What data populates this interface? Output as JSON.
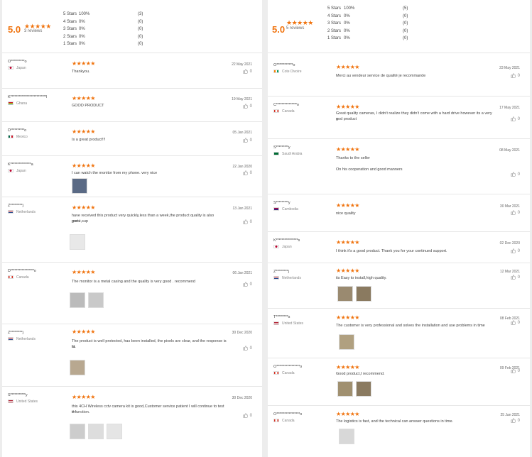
{
  "left": {
    "summary": {
      "score": "5.0",
      "stars": "★★★★★",
      "count": "3 reviews",
      "dist": [
        {
          "label": "5 Stars",
          "pct": "100%",
          "count": "(3)"
        },
        {
          "label": "4 Stars",
          "pct": "0%",
          "count": "(0)"
        },
        {
          "label": "3 Stars",
          "pct": "0%",
          "count": "(0)"
        },
        {
          "label": "2 Stars",
          "pct": "0%",
          "count": "(0)"
        },
        {
          "label": "1 Stars",
          "pct": "0%",
          "count": "(0)"
        }
      ]
    },
    "reviews": [
      {
        "name": "O**********o",
        "country": "Japan",
        "stars": "★★★★★",
        "date": "22 May 2021",
        "lines": [
          "Thankyou."
        ],
        "likes": "0"
      },
      {
        "name": "K**************************l",
        "country": "Ghana",
        "stars": "★★★★★",
        "date": "19 May 2021",
        "lines": [
          "GOOD PRODUCT"
        ],
        "likes": "0"
      },
      {
        "name": "D**********o",
        "country": "Mexico",
        "stars": "★★★★★",
        "date": "05 Jan 2021",
        "lines": [
          "Is a great product!!!"
        ],
        "likes": "0"
      },
      {
        "name": "K***************a",
        "country": "Japan",
        "stars": "★★★★★",
        "date": "22 Jan 2020",
        "lines": [
          "I can watch the monitor from my phone. very nice"
        ],
        "likes": "0"
      },
      {
        "name": "Z*********j",
        "country": "Netherlands",
        "stars": "★★★★★",
        "date": "13 Jan 2021",
        "lines": [
          "have received this product very quickly,less than a week,the product quality is also great,sup",
          "port."
        ],
        "likes": "0"
      },
      {
        "name": "D*****************o",
        "country": "Canada",
        "stars": "★★★★★",
        "date": "06 Jan 2021",
        "lines": [
          "The monitor is a metal casing and the quality is very good . recommend"
        ],
        "likes": "0"
      },
      {
        "name": "Z*********j",
        "country": "Netherlands",
        "stars": "★★★★★",
        "date": "30 Dec 2020",
        "lines": [
          "The product is well protected, has been installed, the pixels are clear, and the response is fa",
          "st."
        ],
        "likes": "0"
      },
      {
        "name": "S***********y",
        "country": "United States",
        "stars": "★★★★★",
        "date": "30 Dec 2020",
        "lines": [
          "this 4CH Wireless cctv camera kit is good,Customer service patient I will continue to test th",
          "e function."
        ],
        "likes": "0"
      }
    ]
  },
  "right": {
    "summary": {
      "score": "5.0",
      "stars": "★★★★★",
      "count": "5 reviews",
      "dist": [
        {
          "label": "5 Stars",
          "pct": "100%",
          "count": "(5)"
        },
        {
          "label": "4 Stars",
          "pct": "0%",
          "count": "(0)"
        },
        {
          "label": "3 Stars",
          "pct": "0%",
          "count": "(0)"
        },
        {
          "label": "2 Stars",
          "pct": "0%",
          "count": "(0)"
        },
        {
          "label": "1 Stars",
          "pct": "0%",
          "count": "(0)"
        }
      ]
    },
    "reviews": [
      {
        "name": "O************o",
        "country": "Cote Divoire",
        "stars": "★★★★★",
        "date": "23 May 2021",
        "lines": [
          "Merci au vendeur service de qualité je recommande"
        ],
        "likes": "0"
      },
      {
        "name": "C***************o",
        "country": "Canada",
        "stars": "★★★★★",
        "date": "17 May 2021",
        "lines": [
          "Great quality cameras, I didn't realize they didn't come with a hard drive however its a very g",
          "ood product"
        ],
        "likes": "0"
      },
      {
        "name": "S*********y",
        "country": "Saudi Arabia",
        "stars": "★★★★★",
        "date": "08 May 2021",
        "lines": [
          "Thanks to the seller",
          "",
          "On his cooperation and good manners"
        ],
        "likes": "0"
      },
      {
        "name": "S*********y",
        "country": "Cambodia",
        "stars": "★★★★★",
        "date": "30 Mar 2021",
        "lines": [
          "nice quality"
        ],
        "likes": "0"
      },
      {
        "name": "K****************s",
        "country": "Japan",
        "stars": "★★★★★",
        "date": "02 Dec 2020",
        "lines": [
          "I think it's a good product. Thank you for your continued support."
        ],
        "likes": "0"
      },
      {
        "name": "Z*********j",
        "country": "Netherlands",
        "stars": "★★★★★",
        "date": "12 Mar 2021",
        "lines": [
          "its Easy to install,high quality."
        ],
        "likes": "0"
      },
      {
        "name": "T*********s",
        "country": "United States",
        "stars": "★★★★★",
        "date": "08 Feb 2021",
        "lines": [
          "The customer is very professional and solves the installation and use problems in time"
        ],
        "likes": "0"
      },
      {
        "name": "O*****************o",
        "country": "Canada",
        "stars": "★★★★★",
        "date": "09 Feb 2021",
        "lines": [
          "Good product,I recommend."
        ],
        "likes": "0"
      },
      {
        "name": "O*****************o",
        "country": "Canada",
        "stars": "★★★★★",
        "date": "25 Jan 2021",
        "lines": [
          "The logistics is fast, and the technical can answer questions in time."
        ],
        "likes": "0"
      }
    ]
  }
}
